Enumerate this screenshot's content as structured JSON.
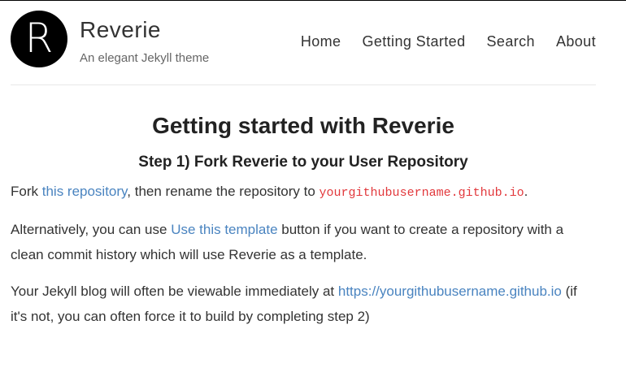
{
  "site": {
    "logo_letter": "R",
    "title": "Reverie",
    "tagline": "An elegant Jekyll theme"
  },
  "nav": {
    "items": [
      {
        "label": "Home"
      },
      {
        "label": "Getting Started"
      },
      {
        "label": "Search"
      },
      {
        "label": "About"
      }
    ]
  },
  "article": {
    "title": "Getting started with Reverie",
    "step1_heading": "Step 1) Fork Reverie to your User Repository",
    "p1": {
      "before": "Fork ",
      "link": "this repository",
      "middle": ", then rename the repository to ",
      "code": "yourgithubusername.github.io",
      "after": "."
    },
    "p2": {
      "before": "Alternatively, you can use ",
      "link": "Use this template",
      "after": " button if you want to create a repository with a clean commit history which will use Reverie as a template."
    },
    "p3": {
      "before": "Your Jekyll blog will often be viewable immediately at ",
      "link": "https://yourgithubusername.github.io",
      "after": " (if it's not, you can often force it to build by completing step 2)"
    }
  },
  "colors": {
    "link": "#4a84c0",
    "code": "#e2383c",
    "logo_bg": "#000000"
  }
}
